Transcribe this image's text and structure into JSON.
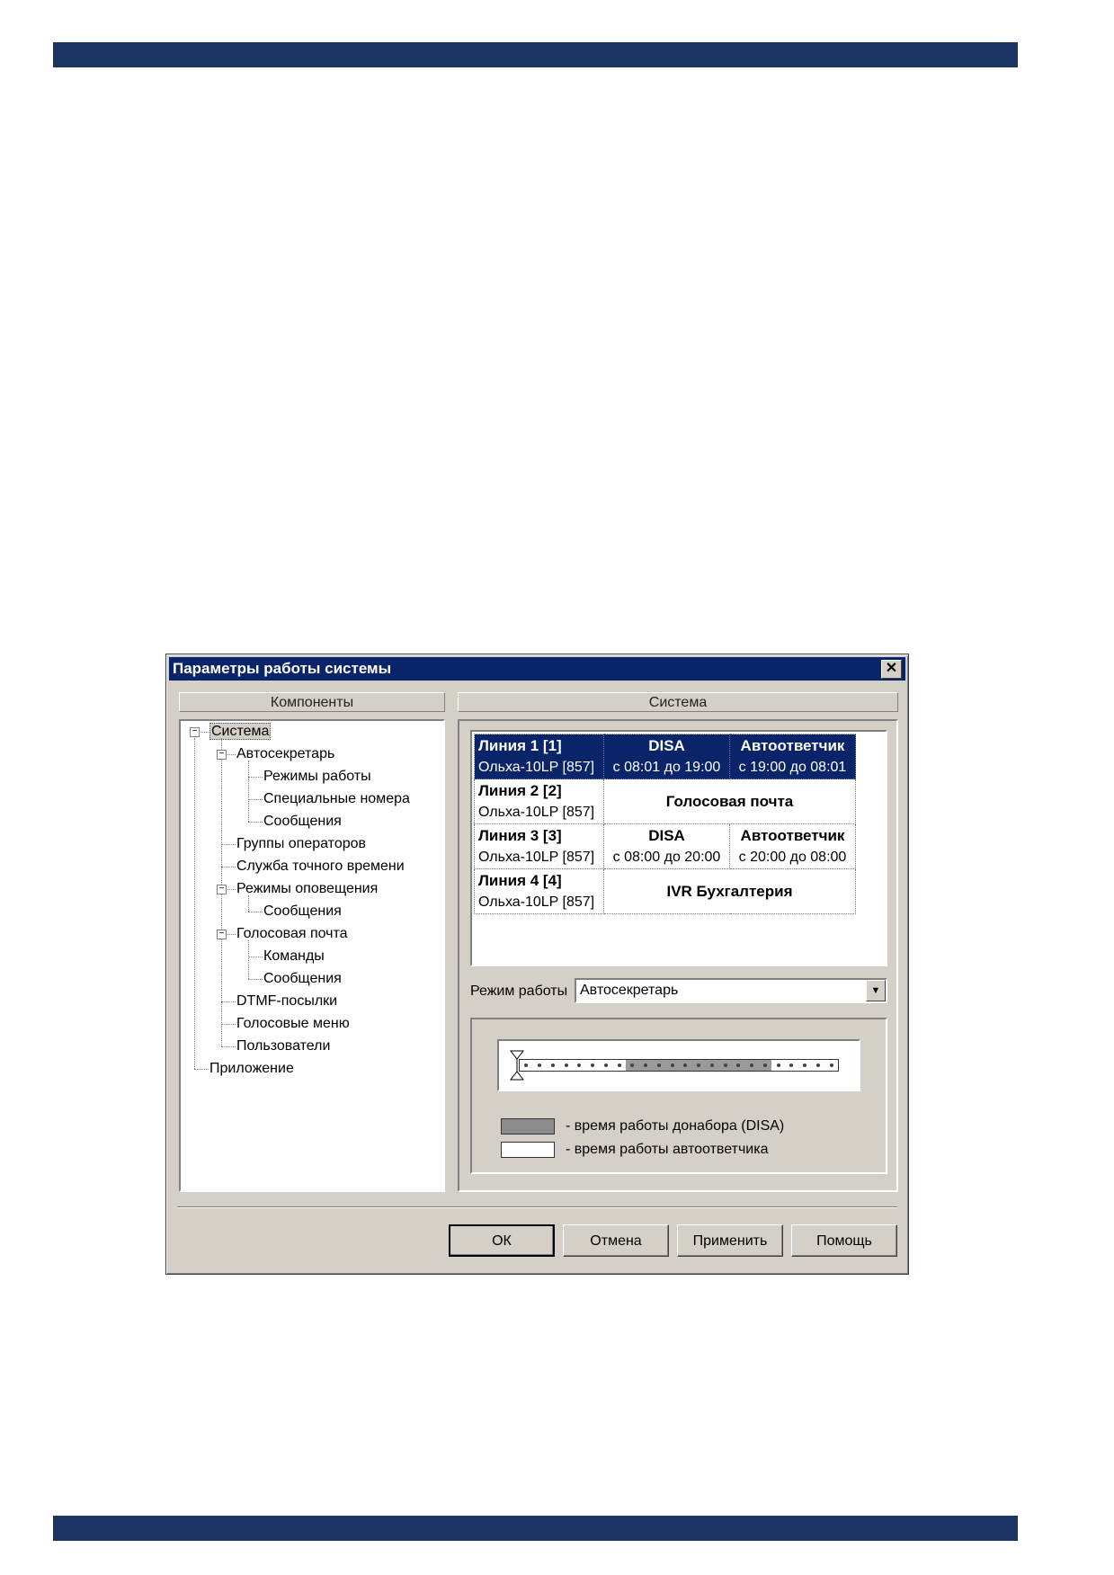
{
  "dialog": {
    "title": "Параметры работы системы",
    "close_glyph": "✕",
    "components_header": "Компоненты",
    "system_header": "Система"
  },
  "tree": [
    {
      "label": "Система",
      "level": 0,
      "expanded": true,
      "selected": true
    },
    {
      "label": "Автосекретарь",
      "level": 1,
      "expanded": true
    },
    {
      "label": "Режимы работы",
      "level": 2
    },
    {
      "label": "Специальные номера",
      "level": 2
    },
    {
      "label": "Сообщения",
      "level": 2
    },
    {
      "label": "Группы операторов",
      "level": 1
    },
    {
      "label": "Служба точного времени",
      "level": 1
    },
    {
      "label": "Режимы оповещения",
      "level": 1,
      "expanded": true
    },
    {
      "label": "Сообщения",
      "level": 2
    },
    {
      "label": "Голосовая почта",
      "level": 1,
      "expanded": true
    },
    {
      "label": "Команды",
      "level": 2
    },
    {
      "label": "Сообщения",
      "level": 2
    },
    {
      "label": "DTMF-посылки",
      "level": 1
    },
    {
      "label": "Голосовые меню",
      "level": 1
    },
    {
      "label": "Пользователи",
      "level": 1
    },
    {
      "label": "Приложение",
      "level": 0
    }
  ],
  "lines": [
    {
      "name": "Линия 1 [1]",
      "device": "Ольха-10LP [857]",
      "selected": true,
      "modes": [
        {
          "title": "DISA",
          "time": "с 08:01 до 19:00"
        },
        {
          "title": "Автоответчик",
          "time": "с 19:00 до 08:01"
        }
      ]
    },
    {
      "name": "Линия 2 [2]",
      "device": "Ольха-10LP [857]",
      "modes": [
        {
          "title": "Голосовая почта"
        }
      ]
    },
    {
      "name": "Линия 3 [3]",
      "device": "Ольха-10LP [857]",
      "modes": [
        {
          "title": "DISA",
          "time": "с 08:00 до 20:00"
        },
        {
          "title": "Автоответчик",
          "time": "с 20:00 до 08:00"
        }
      ]
    },
    {
      "name": "Линия 4 [4]",
      "device": "Ольха-10LP [857]",
      "modes": [
        {
          "title": "IVR Бухгалтерия"
        }
      ]
    }
  ],
  "mode": {
    "label": "Режим работы",
    "value": "Автосекретарь"
  },
  "timeline": {
    "disa_start_hour": 8,
    "disa_end_hour": 19,
    "slider_hour": 0
  },
  "legend": [
    {
      "text": "- время работы донабора (DISA)",
      "color": "#8c8c8c"
    },
    {
      "text": "- время работы автоответчика",
      "color": "#ffffff"
    }
  ],
  "buttons": {
    "ok": "ОК",
    "cancel": "Отмена",
    "apply": "Применить",
    "help": "Помощь"
  },
  "colors": {
    "band": "#1a3561",
    "titlebar": "#0a246a",
    "selection": "#0a246a"
  }
}
